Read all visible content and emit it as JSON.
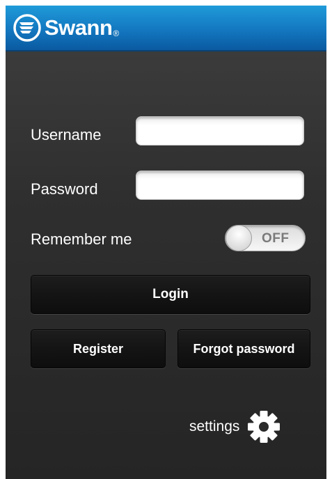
{
  "header": {
    "logo_text": "Swann",
    "logo_mark": "®"
  },
  "login_form": {
    "username_label": "Username",
    "username_value": "",
    "password_label": "Password",
    "password_value": "",
    "remember_label": "Remember me",
    "remember_toggle_state": "OFF"
  },
  "buttons": {
    "login": "Login",
    "register": "Register",
    "forgot_password": "Forgot password"
  },
  "footer": {
    "settings_label": "settings",
    "settings_icon": "gear-icon"
  },
  "colors": {
    "header_blue": "#1377c0",
    "background_dark": "#2f2f2f"
  }
}
